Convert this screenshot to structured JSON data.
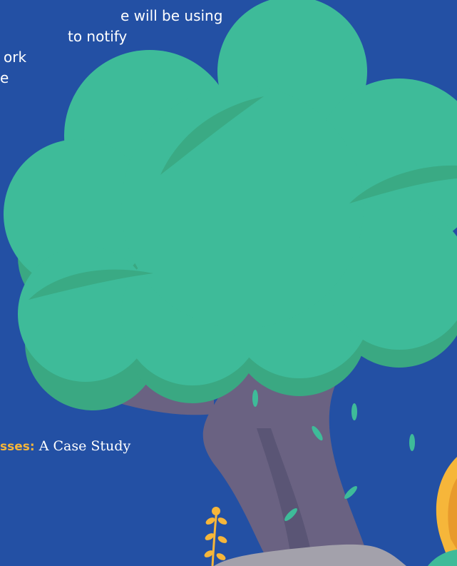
{
  "intro_lines": [
    "e will be using",
    "to notify",
    "ork",
    "e"
  ],
  "caption": {
    "emphasis": "sses:",
    "text": "A Case Study"
  },
  "colors": {
    "background": "#2350a4",
    "foliage": "#3ebb99",
    "foliage_shadow": "#3aa882",
    "trunk": "#6a6282",
    "trunk_dark": "#5a5575",
    "leaf": "#3ebb99",
    "flower": "#f6b63a",
    "rock": "#a3a1ab",
    "caption_emphasis": "#f6b63a",
    "text": "#ffffff"
  }
}
